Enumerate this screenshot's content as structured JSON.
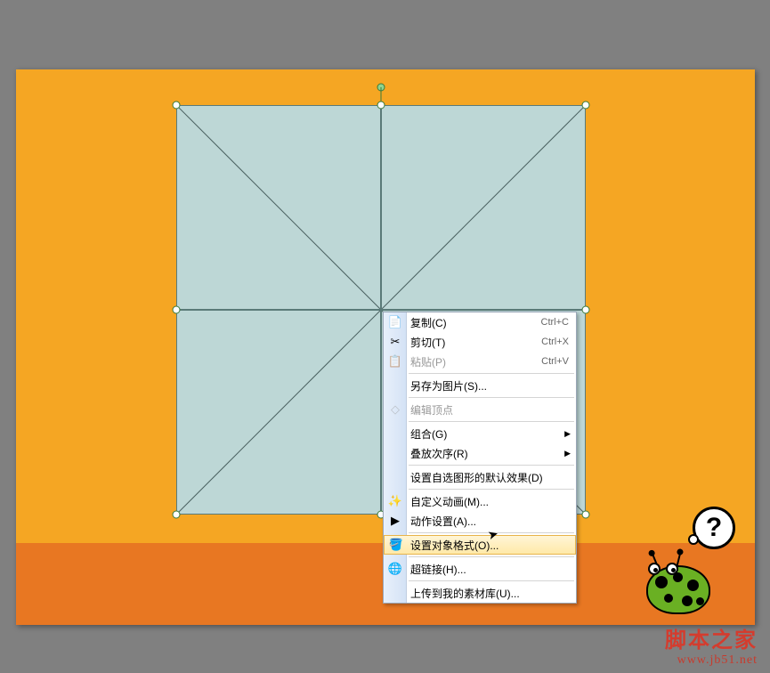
{
  "menu": {
    "copy": {
      "label": "复制(C)",
      "shortcut": "Ctrl+C"
    },
    "cut": {
      "label": "剪切(T)",
      "shortcut": "Ctrl+X"
    },
    "paste": {
      "label": "粘贴(P)",
      "shortcut": "Ctrl+V"
    },
    "save_as_picture": {
      "label": "另存为图片(S)..."
    },
    "edit_points": {
      "label": "编辑顶点"
    },
    "group": {
      "label": "组合(G)"
    },
    "order": {
      "label": "叠放次序(R)"
    },
    "set_autoshape_defaults": {
      "label": "设置自选图形的默认效果(D)"
    },
    "custom_animation": {
      "label": "自定义动画(M)..."
    },
    "action_settings": {
      "label": "动作设置(A)..."
    },
    "format_object": {
      "label": "设置对象格式(O)..."
    },
    "hyperlink": {
      "label": "超链接(H)..."
    },
    "upload_to_gallery": {
      "label": "上传到我的素材库(U)..."
    }
  },
  "bubble": {
    "text": "?"
  },
  "watermark": {
    "line1": "脚本之家",
    "line2": "www.jb51.net"
  }
}
